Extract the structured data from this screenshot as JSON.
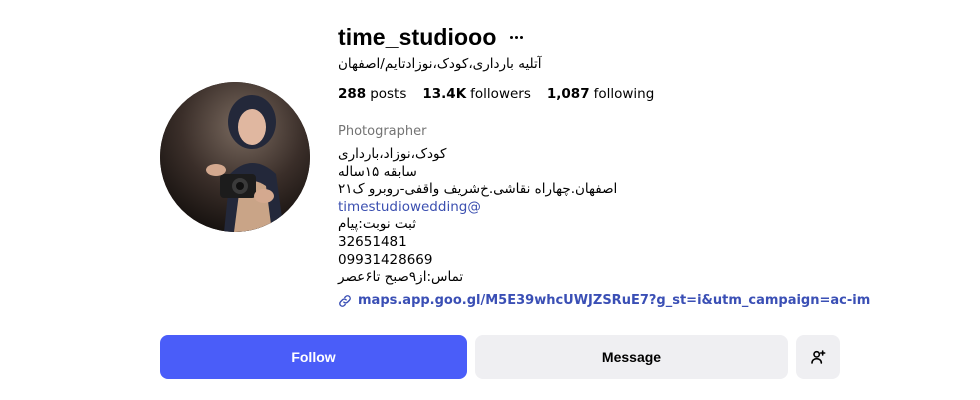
{
  "profile": {
    "username": "time_studiooo",
    "more_icon": "more-horizontal-icon",
    "full_name": "آتلیه بارداری،کودک،نوزادتایم/اصفهان",
    "stats": [
      {
        "value": "288",
        "label": "posts"
      },
      {
        "value": "13.4K",
        "label": "followers"
      },
      {
        "value": "1,087",
        "label": "following"
      }
    ],
    "category": "Photographer",
    "bio_lines": [
      "کودک،نوزاد،بارداری",
      "سابقه ۱۵ساله",
      "اصفهان.چهاراه نقاشی.خ‌شریف واقفی-روبرو ک۲۱",
      "@timestudiowedding",
      "ثبت نوبت:پیام",
      "32651481",
      "09931428669",
      "تماس:از۹صبح تا۶عصر"
    ],
    "link": {
      "icon": "link-icon",
      "text": "maps.app.goo.gl/M5E39whcUWJZSRuE7?g_st=i&utm_campaign=ac-im"
    }
  },
  "actions": {
    "follow_label": "Follow",
    "message_label": "Message",
    "add_user_icon": "add-user-icon"
  },
  "colors": {
    "follow_button": "#4a5df9",
    "secondary_button": "#efeff2",
    "link": "#3a4fb5",
    "muted_text": "#737373"
  }
}
